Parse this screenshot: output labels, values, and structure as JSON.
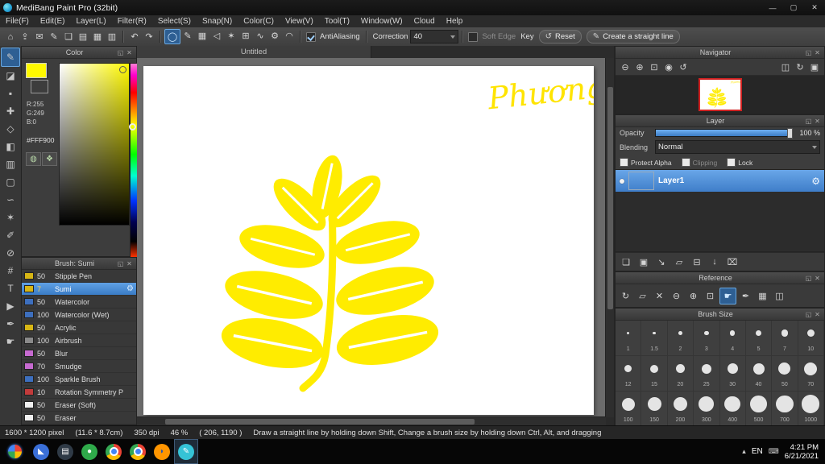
{
  "icons": {
    "gear": "⚙",
    "float": "◱",
    "close": "✕"
  },
  "title_bar": {
    "title": "MediBang Paint Pro (32bit)",
    "minimize": "—",
    "maximize": "▢",
    "close": "✕"
  },
  "menu_bar": {
    "items": [
      "File(F)",
      "Edit(E)",
      "Layer(L)",
      "Filter(R)",
      "Select(S)",
      "Snap(N)",
      "Color(C)",
      "View(V)",
      "Tool(T)",
      "Window(W)",
      "Cloud",
      "Help"
    ]
  },
  "toolbar": {
    "file_icons": [
      {
        "name": "save-icon",
        "glyph": "⌂"
      },
      {
        "name": "export-icon",
        "glyph": "⇪"
      },
      {
        "name": "publish-icon",
        "glyph": "✉"
      },
      {
        "name": "material-icon",
        "glyph": "✎"
      },
      {
        "name": "new-canvas-icon",
        "glyph": "❏"
      },
      {
        "name": "open-canvas-icon",
        "glyph": "▤"
      },
      {
        "name": "grid-view-icon",
        "glyph": "▦"
      },
      {
        "name": "panel-layout-icon",
        "glyph": "▥"
      }
    ],
    "history_icons": [
      {
        "name": "undo-icon",
        "glyph": "↶"
      },
      {
        "name": "redo-icon",
        "glyph": "↷"
      }
    ],
    "tool_option_icons": [
      {
        "name": "ellipse-tool-option-icon",
        "glyph": "◯",
        "active": true
      },
      {
        "name": "brush-type-icon",
        "glyph": "✎"
      },
      {
        "name": "grid-snap-icon",
        "glyph": "▦"
      },
      {
        "name": "polyline-snap-icon",
        "glyph": "◁"
      },
      {
        "name": "radial-snap-icon",
        "glyph": "✶"
      },
      {
        "name": "cross-snap-icon",
        "glyph": "⊞"
      },
      {
        "name": "curve-snap-icon",
        "glyph": "∿"
      },
      {
        "name": "snap-settings-icon",
        "glyph": "⚙"
      },
      {
        "name": "perspective-snap-icon",
        "glyph": "◠"
      }
    ],
    "antialiasing_label": "AntiAliasing",
    "correction_label": "Correction",
    "correction_value": "40",
    "soft_edge_label": "Soft Edge",
    "key_label": "Key",
    "reset_label": "Reset",
    "reset_glyph": "↺",
    "straight_line_label": "Create a straight line",
    "straight_line_glyph": "✎"
  },
  "tool_strip": {
    "tools": [
      {
        "name": "brush-tool-icon",
        "glyph": "✎",
        "active": true
      },
      {
        "name": "eraser-tool-icon",
        "glyph": "◪"
      },
      {
        "name": "dot-tool-icon",
        "glyph": "▪"
      },
      {
        "name": "move-tool-icon",
        "glyph": "✚"
      },
      {
        "name": "fill-tool-icon",
        "glyph": "◇"
      },
      {
        "name": "bucket-tool-icon",
        "glyph": "◧"
      },
      {
        "name": "gradient-tool-icon",
        "glyph": "▥"
      },
      {
        "name": "select-tool-icon",
        "glyph": "▢"
      },
      {
        "name": "lasso-tool-icon",
        "glyph": "∽"
      },
      {
        "name": "magic-wand-tool-icon",
        "glyph": "✶"
      },
      {
        "name": "select-pen-tool-icon",
        "glyph": "✐"
      },
      {
        "name": "select-eraser-tool-icon",
        "glyph": "⊘"
      },
      {
        "name": "divide-tool-icon",
        "glyph": "#"
      },
      {
        "name": "text-tool-icon",
        "glyph": "T"
      },
      {
        "name": "operation-tool-icon",
        "glyph": "▶"
      },
      {
        "name": "eyedropper-tool-icon",
        "glyph": "✒"
      },
      {
        "name": "hand-tool-icon",
        "glyph": "☛"
      }
    ]
  },
  "color_panel": {
    "title": "Color",
    "rgb": [
      "R:255",
      "G:249",
      "B:0"
    ],
    "hex": "#FFF900",
    "extra_icons": [
      {
        "name": "color-wheel-icon",
        "glyph": "◍"
      },
      {
        "name": "palette-icon",
        "glyph": "❖"
      }
    ]
  },
  "brush_panel": {
    "title": "Brush: Sumi",
    "brushes": [
      {
        "size": "50",
        "name": "Stipple Pen",
        "swatch": "#d7b615"
      },
      {
        "size": "7",
        "name": "Sumi",
        "swatch": "#d7b615",
        "selected": true,
        "size_color": "#ffd24d"
      },
      {
        "size": "50",
        "name": "Watercolor",
        "swatch": "#3d6fbe"
      },
      {
        "size": "100",
        "name": "Watercolor (Wet)",
        "swatch": "#3d6fbe"
      },
      {
        "size": "50",
        "name": "Acrylic",
        "swatch": "#d7b615"
      },
      {
        "size": "100",
        "name": "Airbrush",
        "swatch": "#8a8a8a"
      },
      {
        "size": "50",
        "name": "Blur",
        "swatch": "#c66ad0"
      },
      {
        "size": "70",
        "name": "Smudge",
        "swatch": "#c66ad0"
      },
      {
        "size": "100",
        "name": "Sparkle Brush",
        "swatch": "#3d6fbe"
      },
      {
        "size": "10",
        "name": "Rotation Symmetry P",
        "swatch": "#c23b3b"
      },
      {
        "size": "50",
        "name": "Eraser (Soft)",
        "swatch": "#f0f0f0"
      },
      {
        "size": "50",
        "name": "Eraser",
        "swatch": "#f0f0f0"
      }
    ],
    "bottom_icons": [
      {
        "name": "brush-sync-icon",
        "glyph": "↑"
      },
      {
        "name": "add-brush-icon",
        "glyph": "❏"
      },
      {
        "name": "edit-brush-icon",
        "glyph": "✎"
      },
      {
        "name": "brush-folder-icon",
        "glyph": "▱"
      },
      {
        "name": "delete-brush-icon",
        "glyph": "⌧"
      }
    ]
  },
  "canvas": {
    "tab": "Untitled",
    "signature": "Phương",
    "paint_color": "#ffec00"
  },
  "navigator": {
    "title": "Navigator",
    "icons_left": [
      {
        "name": "nav-zoom-out-icon",
        "glyph": "⊖"
      },
      {
        "name": "nav-zoom-in-icon",
        "glyph": "⊕"
      },
      {
        "name": "nav-zoom-fit-icon",
        "glyph": "⊡"
      },
      {
        "name": "nav-zoom-100-icon",
        "glyph": "◉"
      },
      {
        "name": "nav-rotate-reset-icon",
        "glyph": "↺"
      }
    ],
    "icons_right": [
      {
        "name": "nav-flip-icon",
        "glyph": "◫"
      },
      {
        "name": "nav-rotate-right-icon",
        "glyph": "↻"
      },
      {
        "name": "nav-spin-icon",
        "glyph": "▣"
      }
    ]
  },
  "layer_panel": {
    "title": "Layer",
    "opacity_label": "Opacity",
    "opacity_value": "100 %",
    "blending_label": "Blending",
    "blending_value": "Normal",
    "protect_alpha_label": "Protect Alpha",
    "clipping_label": "Clipping",
    "lock_label": "Lock",
    "layer_name": "Layer1",
    "bottom_icons": [
      {
        "name": "add-layer-icon",
        "glyph": "❏"
      },
      {
        "name": "duplicate-layer-icon",
        "glyph": "▣"
      },
      {
        "name": "layer-transfer-icon",
        "glyph": "↘"
      },
      {
        "name": "add-layer-folder-icon",
        "glyph": "▱"
      },
      {
        "name": "merge-layer-icon",
        "glyph": "⊟"
      },
      {
        "name": "merge-down-icon",
        "glyph": "↓"
      },
      {
        "name": "delete-layer-icon",
        "glyph": "⌧"
      }
    ]
  },
  "reference": {
    "title": "Reference",
    "icons": [
      {
        "name": "ref-rotate-icon",
        "glyph": "↻"
      },
      {
        "name": "ref-open-icon",
        "glyph": "▱"
      },
      {
        "name": "ref-clear-icon",
        "glyph": "✕"
      },
      {
        "name": "ref-zoom-out-icon",
        "glyph": "⊖"
      },
      {
        "name": "ref-zoom-in-icon",
        "glyph": "⊕"
      },
      {
        "name": "ref-fit-icon",
        "glyph": "⊡"
      },
      {
        "name": "ref-hand-icon",
        "glyph": "☛",
        "active": true
      },
      {
        "name": "ref-eyedropper-icon",
        "glyph": "✒"
      },
      {
        "name": "ref-grid-icon",
        "glyph": "▦"
      },
      {
        "name": "ref-flip-icon",
        "glyph": "◫"
      }
    ]
  },
  "brush_size": {
    "title": "Brush Size",
    "sizes": [
      "1",
      "1.5",
      "2",
      "3",
      "4",
      "5",
      "7",
      "10",
      "12",
      "15",
      "20",
      "25",
      "30",
      "40",
      "50",
      "70",
      "100",
      "150",
      "200",
      "300",
      "400",
      "500",
      "700",
      "1000"
    ]
  },
  "status_bar": {
    "size": "1600 * 1200 pixel",
    "cm": "(11.6 * 8.7cm)",
    "dpi": "350 dpi",
    "zoom": "46 %",
    "coords": "( 206, 1190 )",
    "hint": "Draw a straight line by holding down Shift, Change a brush size by holding down Ctrl, Alt, and dragging"
  },
  "taskbar": {
    "icons": [
      {
        "name": "taskbar-app-1-button",
        "kind": "plain",
        "bg": "#3a6fd8",
        "glyph": "◣"
      },
      {
        "name": "taskbar-app-2-button",
        "kind": "plain",
        "bg": "#2f3a46",
        "glyph": "▤"
      },
      {
        "name": "taskbar-app-3-button",
        "kind": "plain",
        "bg": "#2faa4a",
        "glyph": "●"
      },
      {
        "name": "taskbar-chrome-button",
        "kind": "chrome",
        "center": "#4285f4"
      },
      {
        "name": "taskbar-chrome-2-button",
        "kind": "chrome",
        "center": "#4285f4"
      },
      {
        "name": "taskbar-firefox-button",
        "kind": "plain",
        "bg": "#ff9500",
        "glyph": "◗",
        "glyph_color": "#3356a8"
      },
      {
        "name": "taskbar-medibang-button",
        "kind": "plain",
        "bg": "#35c3d6",
        "glyph": "✎",
        "active": true
      }
    ],
    "tray_arrow": "▴",
    "keyboard_glyph": "⌨",
    "language": "EN",
    "time": "4:21 PM",
    "date": "6/21/2021"
  }
}
